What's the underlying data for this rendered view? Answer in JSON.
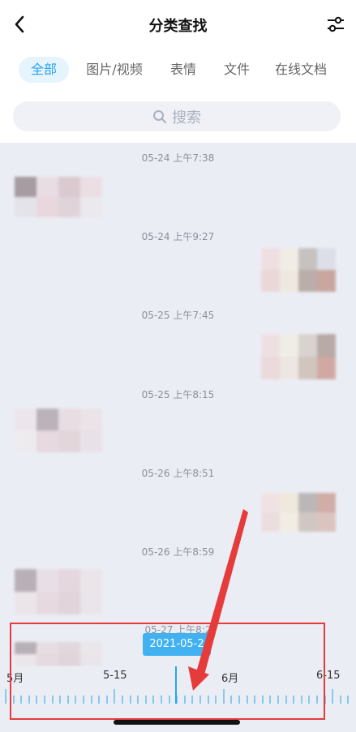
{
  "header": {
    "title": "分类查找",
    "back_icon": "chevron-left-icon",
    "filter_icon": "sliders-icon"
  },
  "tabs": [
    {
      "label": "全部",
      "active": true
    },
    {
      "label": "图片/视频",
      "active": false
    },
    {
      "label": "表情",
      "active": false
    },
    {
      "label": "文件",
      "active": false
    },
    {
      "label": "在线文档",
      "active": false
    }
  ],
  "search": {
    "placeholder": "搜索",
    "icon": "search-icon"
  },
  "feed": {
    "timestamps": [
      "05-24 上午7:38",
      "05-24 上午9:27",
      "05-25 上午7:45",
      "05-25 上午8:15",
      "05-26 上午8:51",
      "05-26 上午8:59",
      "05-27 上午8:2"
    ]
  },
  "timeline": {
    "selected_date": "2021-05-2",
    "labels": [
      "5月",
      "5-15",
      "6月",
      "6-15"
    ]
  },
  "colors": {
    "accent": "#2aa4f0",
    "highlight_box": "#e53b3b"
  }
}
